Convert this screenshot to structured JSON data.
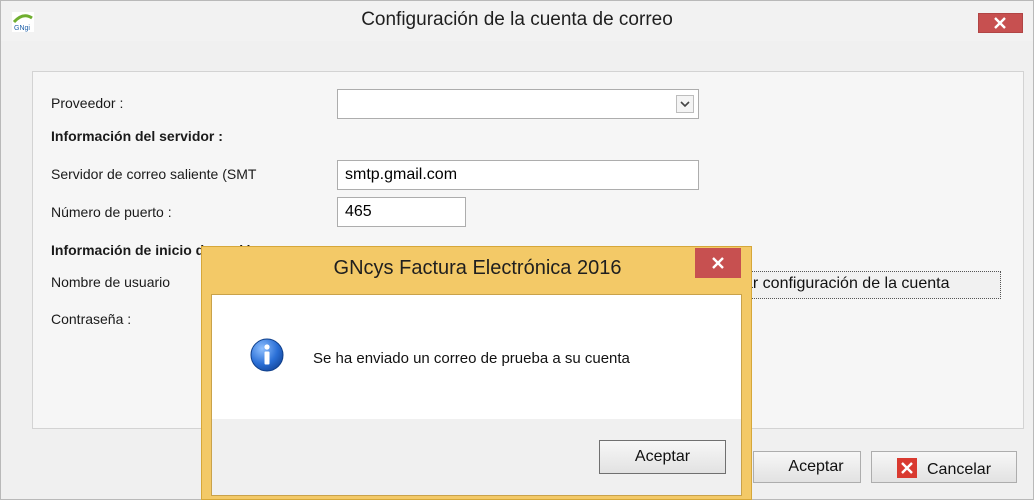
{
  "window": {
    "title": "Configuración de la cuenta de correo",
    "logo_text": "GNgi"
  },
  "form": {
    "provider_label": "Proveedor :",
    "provider_value": "",
    "server_section": "Información del servidor :",
    "smtp_label": "Servidor de correo saliente  (SMT",
    "smtp_value": "smtp.gmail.com",
    "port_label": "Número de puerto :",
    "port_value": "465",
    "login_section": "Información de inicio de sesión:",
    "username_label": "Nombre de usuario",
    "password_label": "Contraseña :",
    "test_button": "ar configuración de la cuenta"
  },
  "footer": {
    "accept_button": "Aceptar",
    "cancel_button": "Cancelar"
  },
  "dialog": {
    "title": "GNcys Factura Electrónica 2016",
    "message": "Se ha enviado un correo de prueba a su cuenta",
    "ok_button": "Aceptar"
  },
  "colors": {
    "close_red": "#c75050",
    "dialog_frame": "#f3c967",
    "info_blue": "#1f64c8"
  }
}
